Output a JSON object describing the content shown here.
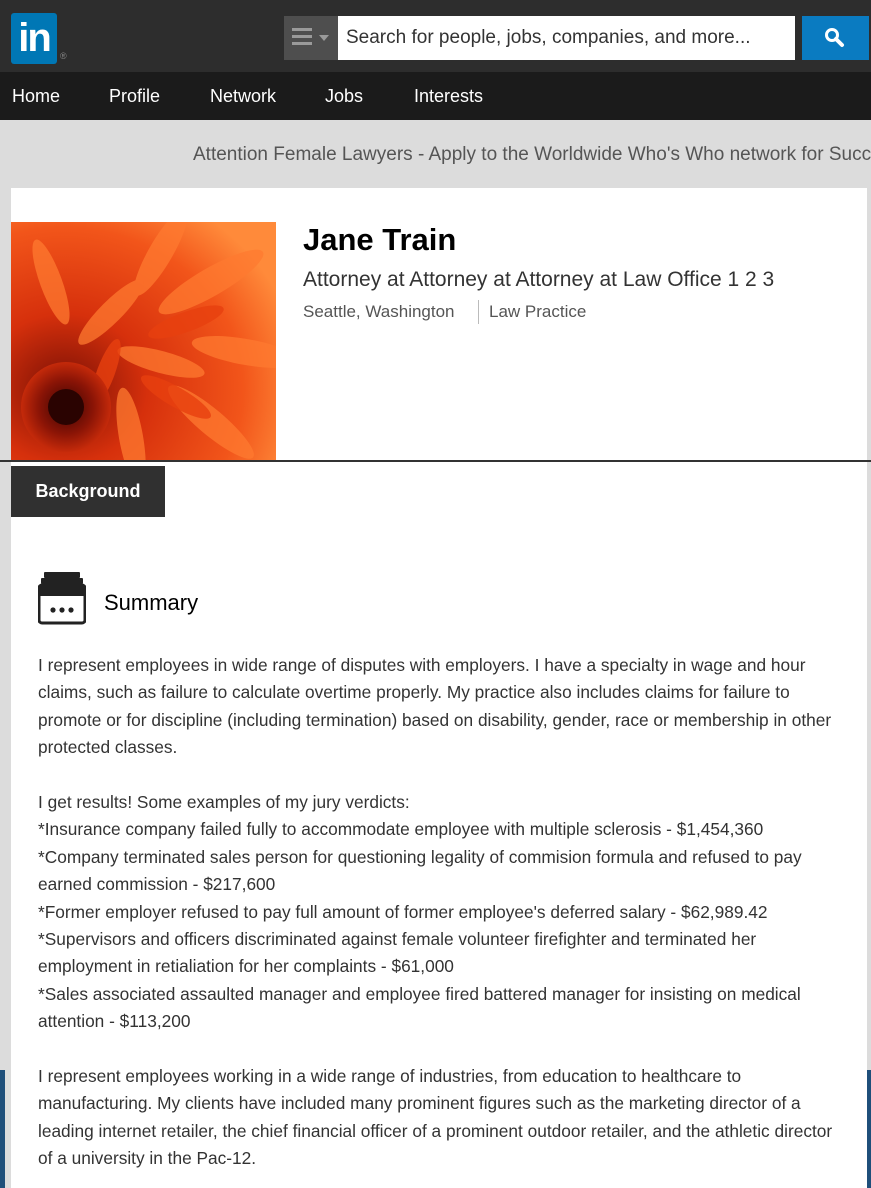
{
  "header": {
    "logo_text": "in",
    "logo_mark": "®",
    "search": {
      "placeholder": "Search for people, jobs, companies, and more..."
    },
    "icons": {
      "menu": "menu-icon",
      "search": "search-icon"
    },
    "colors": {
      "brand": "#0077b5",
      "topbar": "#2d2d2d",
      "search_button": "#0a7bc1"
    }
  },
  "nav": {
    "items": [
      "Home",
      "Profile",
      "Network",
      "Jobs",
      "Interests"
    ]
  },
  "ad": {
    "text": "Attention Female Lawyers - Apply to the Worldwide Who's Who network for Succe"
  },
  "profile": {
    "name": "Jane Train",
    "headline": "Attorney at Attorney at Attorney at Law Office 1 2 3",
    "location": "Seattle, Washington",
    "industry": "Law Practice"
  },
  "background": {
    "tab_label": "Background",
    "summary": {
      "title": "Summary",
      "icon": "summary-icon",
      "lines": [
        "I represent employees in wide range of disputes with employers. I have a specialty in wage and hour",
        "claims, such as failure to calculate overtime properly. My practice also includes claims for failure to",
        "promote or for discipline (including termination) based on disability, gender, race or membership in other",
        "protected classes.",
        "",
        "I get results! Some examples of my jury verdicts:",
        "*Insurance company failed fully to accommodate employee with multiple sclerosis - $1,454,360",
        "*Company terminated sales person for questioning legality of commision formula and refused to pay",
        "earned commission - $217,600",
        "*Former employer refused to pay full amount of former employee's deferred salary - $62,989.42",
        "*Supervisors and officers discriminated against female volunteer firefighter and terminated her",
        "employment in retialiation for her complaints - $61,000",
        "*Sales associated assaulted manager and employee fired battered manager for insisting on medical",
        "attention - $113,200",
        "",
        "I represent employees working in a wide range of industries, from education to healthcare to",
        "manufacturing. My clients have included many prominent figures such as the marketing director of a",
        "leading internet retailer, the chief financial officer of a prominent outdoor retailer, and the athletic director",
        "of a university in the Pac-12."
      ]
    }
  }
}
